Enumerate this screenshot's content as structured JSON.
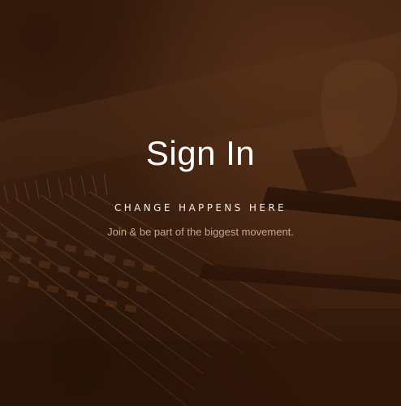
{
  "hero": {
    "title": "Sign In",
    "tagline": "CHANGE HAPPENS HERE",
    "subtitle": "Join & be part of the biggest movement."
  },
  "background": {
    "image_subject": "hand-weaving-loom",
    "tint_color": "#4a2814"
  }
}
